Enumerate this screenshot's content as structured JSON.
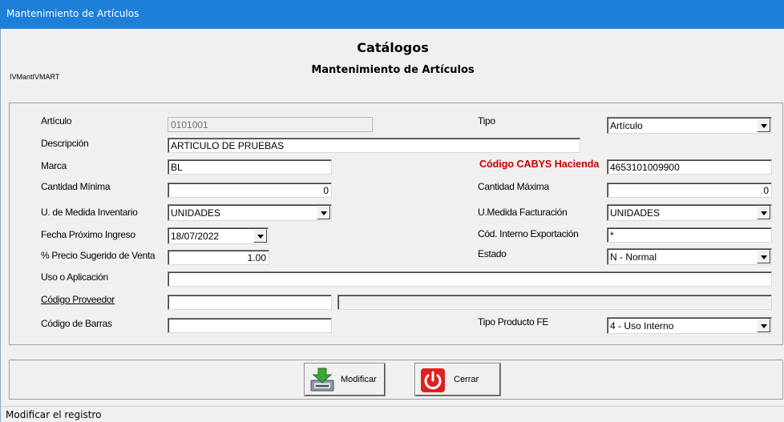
{
  "window": {
    "title": "Mantenimiento de Artículos"
  },
  "header": {
    "title": "Catálogos",
    "subtitle": "Mantenimiento de Artículos",
    "form_code": "IVMantIVMART"
  },
  "form": {
    "articulo": {
      "label": "Artículo",
      "value": "0101001"
    },
    "tipo": {
      "label": "Tipo",
      "value": "Artículo"
    },
    "descripcion": {
      "label": "Descripción",
      "value": "ARTICULO DE PRUEBAS"
    },
    "marca": {
      "label": "Marca",
      "value": "BL"
    },
    "cabys": {
      "label": "Código CABYS Hacienda",
      "value": "4653101009900"
    },
    "cantidad_minima": {
      "label": "Cantidad Mínima",
      "value": "0"
    },
    "cantidad_maxima": {
      "label": "Cantidad Máxima",
      "value": "0"
    },
    "um_inventario": {
      "label": "U. de Medida Inventario",
      "value": "UNIDADES"
    },
    "um_facturacion": {
      "label": "U.Medida Facturación",
      "value": "UNIDADES"
    },
    "fecha_ingreso": {
      "label": "Fecha Próximo Ingreso",
      "value": "18/07/2022"
    },
    "cod_exportacion": {
      "label": "Cód. Interno Exportación",
      "value": "*"
    },
    "precio_sugerido": {
      "label": "% Precio Sugerido de Venta",
      "value": "1.00"
    },
    "estado": {
      "label": "Estado",
      "value": "N - Normal"
    },
    "uso": {
      "label": "Uso o Aplicación",
      "value": ""
    },
    "proveedor": {
      "label": "Código Proveedor",
      "value": "",
      "name_value": ""
    },
    "barras": {
      "label": "Código de Barras",
      "value": ""
    },
    "tipo_producto": {
      "label": "Tipo Producto FE",
      "value": "4 - Uso Interno"
    }
  },
  "buttons": {
    "modificar": {
      "label": "Modificar",
      "icon": "save-disk-icon",
      "accent": "#3aa63a"
    },
    "cerrar": {
      "label": "Cerrar",
      "icon": "power-icon",
      "accent": "#e02020"
    }
  },
  "status": {
    "text": "Modificar el registro"
  },
  "colors": {
    "titlebar": "#1e7fd9",
    "cabys_label": "#c00000",
    "window_bg": "#f0f0f0"
  }
}
